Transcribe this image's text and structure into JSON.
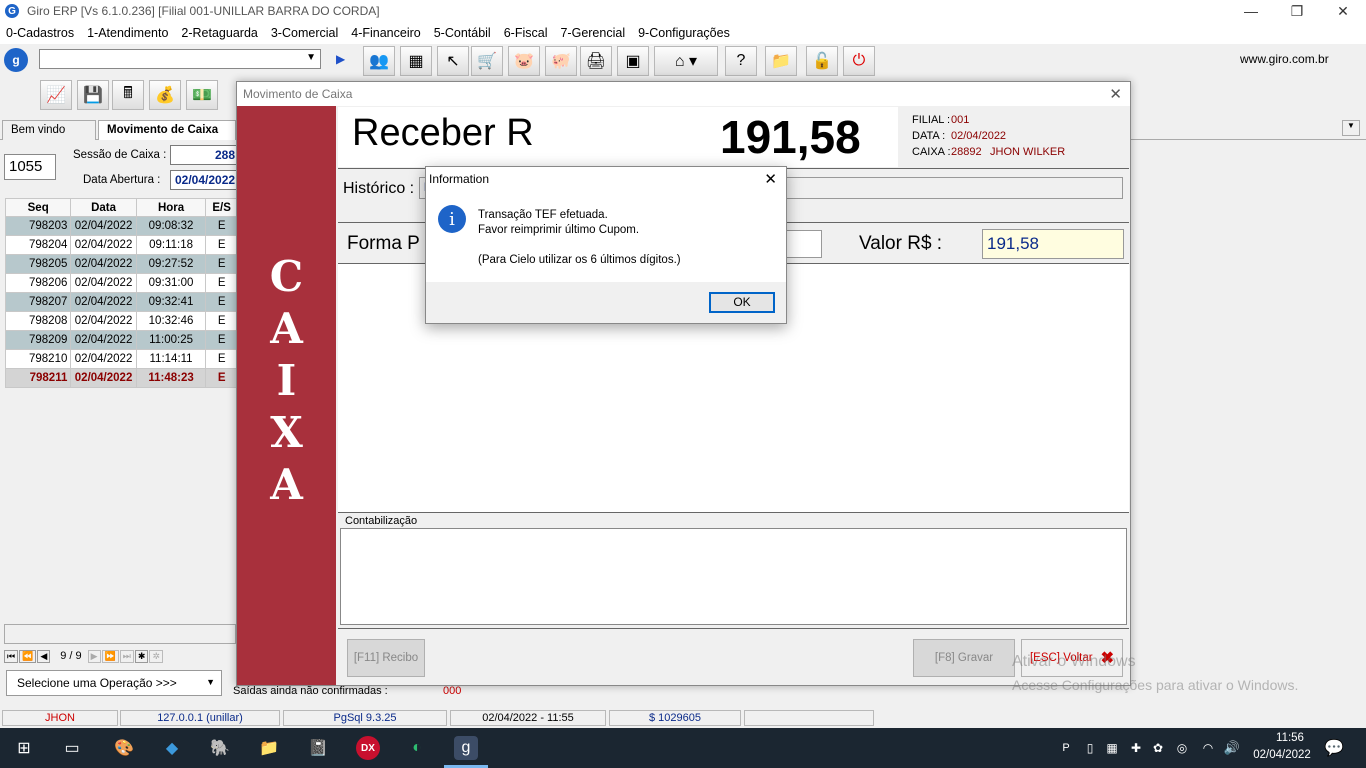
{
  "window": {
    "title": "Giro ERP   [Vs 6.1.0.236]  [Filial 001-UNILLAR BARRA DO CORDA]",
    "website": "www.giro.com.br"
  },
  "menu": [
    "0-Cadastros",
    "1-Atendimento",
    "2-Retaguarda",
    "3-Comercial",
    "4-Financeiro",
    "5-Contábil",
    "6-Fiscal",
    "7-Gerencial",
    "9-Configurações"
  ],
  "tabs": [
    "Bem vindo",
    "Movimento de Caixa"
  ],
  "left": {
    "code": "1055",
    "sessao_label": "Sessão de Caixa :",
    "sessao_value": "288",
    "abertura_label": "Data Abertura :",
    "abertura_value": "02/04/2022",
    "columns": [
      "Seq",
      "Data",
      "Hora",
      "E/S"
    ],
    "rows": [
      [
        "798203",
        "02/04/2022",
        "09:08:32",
        "E"
      ],
      [
        "798204",
        "02/04/2022",
        "09:11:18",
        "E"
      ],
      [
        "798205",
        "02/04/2022",
        "09:27:52",
        "E"
      ],
      [
        "798206",
        "02/04/2022",
        "09:31:00",
        "E"
      ],
      [
        "798207",
        "02/04/2022",
        "09:32:41",
        "E"
      ],
      [
        "798208",
        "02/04/2022",
        "10:32:46",
        "E"
      ],
      [
        "798209",
        "02/04/2022",
        "11:00:25",
        "E"
      ],
      [
        "798210",
        "02/04/2022",
        "11:14:11",
        "E"
      ],
      [
        "798211",
        "02/04/2022",
        "11:48:23",
        "E"
      ]
    ],
    "nav_counter": "9 / 9",
    "operation": "Selecione uma Operação  >>>",
    "saidas_label": "Saídas ainda não confirmadas :",
    "saidas_value": "000"
  },
  "dialog": {
    "title": "Movimento de Caixa",
    "side_letters": [
      "C",
      "A",
      "I",
      "X",
      "A"
    ],
    "receber": "Receber R",
    "amount": "191,58",
    "filial_label": "FILIAL :",
    "filial": "001",
    "data_label": "DATA  :",
    "data": "02/04/2022",
    "caixa_label": "CAIXA :",
    "caixa": "28892",
    "user": "JHON WILKER",
    "historico_label": "Histórico :",
    "historico_value": "R",
    "forma_label": "Forma P",
    "valor_label": "Valor R$ :",
    "valor_value": "191,58",
    "contab_label": "Contabilização",
    "btn_recibo": "[F11] Recibo",
    "btn_gravar": "[F8] Gravar",
    "btn_voltar": "[ESC] Voltar"
  },
  "info": {
    "title": "Information",
    "line1": "Transação TEF efetuada.",
    "line2": "Favor reimprimir último Cupom.",
    "line3": "(Para Cielo utilizar os 6 últimos dígitos.)",
    "ok": "OK"
  },
  "watermark": {
    "line1": "Ativar o Windows",
    "line2": "Acesse Configurações para ativar o Windows."
  },
  "status": [
    "JHON",
    "127.0.0.1 (unillar)",
    "PgSql 9.3.25",
    "02/04/2022 - 11:55",
    "$ 1029605"
  ],
  "clock": {
    "time": "11:56",
    "date": "02/04/2022"
  },
  "colors": {
    "accent_red": "#a8303c",
    "dark_red": "#8b0000",
    "taskbar": "#1b2631"
  }
}
